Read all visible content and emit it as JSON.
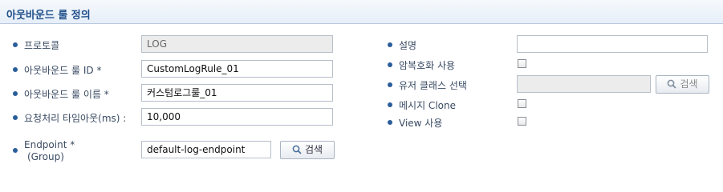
{
  "header": {
    "title": "아웃바운드 룰 정의"
  },
  "left": {
    "protocol": {
      "label": "프로토콜",
      "value": "LOG"
    },
    "rule_id": {
      "label": "아웃바운드 룰 ID *",
      "value": "CustomLogRule_01"
    },
    "rule_name": {
      "label": "아웃바운드 룰 이름 *",
      "value": "커스텀로그룰_01"
    },
    "timeout": {
      "label": "요청처리 타임아웃(ms) :",
      "value": "10,000"
    },
    "endpoint": {
      "label_line1": "Endpoint *",
      "label_line2": "(Group)",
      "value": "default-log-endpoint",
      "search_label": "검색"
    }
  },
  "right": {
    "description": {
      "label": "설명",
      "value": ""
    },
    "encryption": {
      "label": "암복호화 사용",
      "checked": false
    },
    "user_class": {
      "label": "유저 클래스 선택",
      "value": "",
      "search_label": "검색"
    },
    "message_clone": {
      "label": "메시지 Clone",
      "checked": false
    },
    "view_use": {
      "label": "View 사용",
      "checked": false
    }
  }
}
